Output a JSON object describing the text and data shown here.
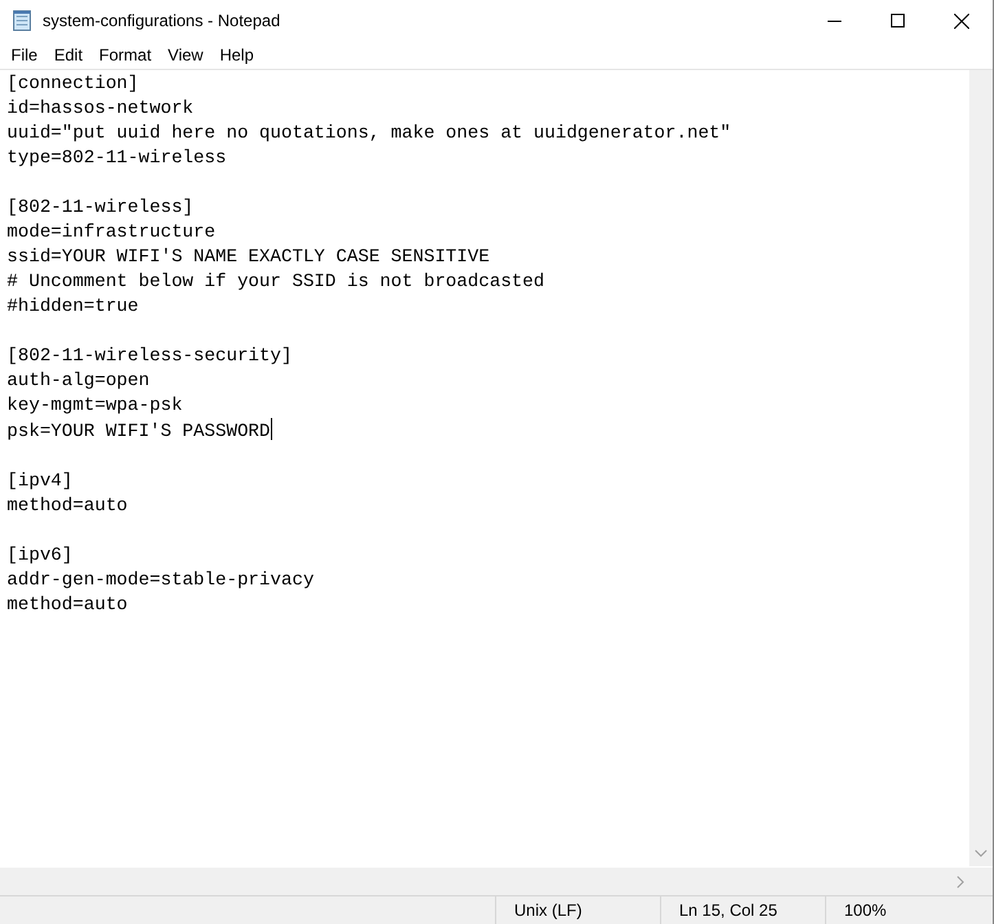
{
  "window": {
    "title": "system-configurations - Notepad"
  },
  "menu": [
    "File",
    "Edit",
    "Format",
    "View",
    "Help"
  ],
  "editor": {
    "sections": [
      {
        "lines": [
          "[connection]",
          "id=hassos-network",
          "uuid=\"put uuid here no quotations, make ones at uuidgenerator.net\"",
          "type=802-11-wireless"
        ],
        "caret_at_end": false
      },
      {
        "lines": [
          "[802-11-wireless]",
          "mode=infrastructure",
          "ssid=YOUR WIFI'S NAME EXACTLY CASE SENSITIVE",
          "# Uncomment below if your SSID is not broadcasted",
          "#hidden=true"
        ],
        "caret_at_end": false
      },
      {
        "lines": [
          "[802-11-wireless-security]",
          "auth-alg=open",
          "key-mgmt=wpa-psk",
          "psk=YOUR WIFI'S PASSWORD"
        ],
        "caret_at_end": true
      },
      {
        "lines": [
          "[ipv4]",
          "method=auto"
        ],
        "caret_at_end": false
      },
      {
        "lines": [
          "[ipv6]",
          "addr-gen-mode=stable-privacy",
          "method=auto"
        ],
        "caret_at_end": false
      }
    ]
  },
  "status_bar": [
    "Unix (LF)",
    "Ln 15, Col 25",
    "100%"
  ]
}
